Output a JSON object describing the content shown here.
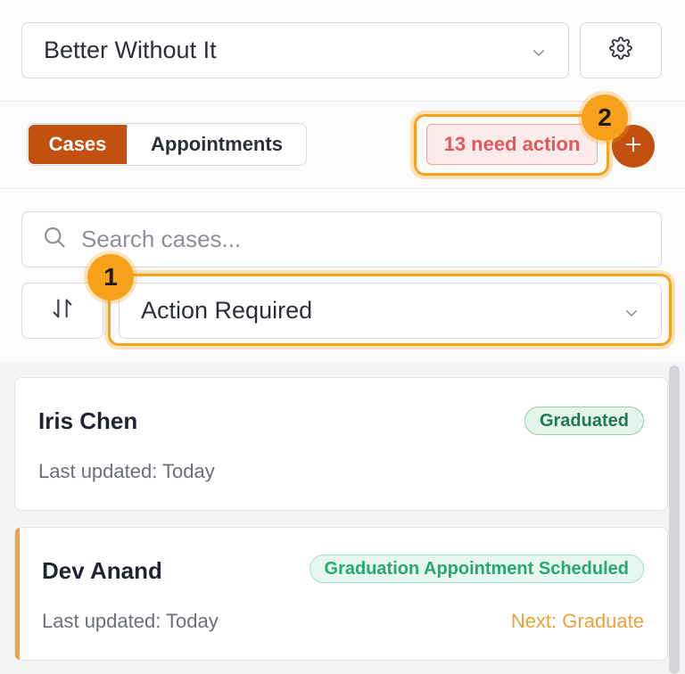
{
  "program": {
    "selected": "Better Without It"
  },
  "tabs": [
    {
      "label": "Cases",
      "active": true
    },
    {
      "label": "Appointments",
      "active": false
    }
  ],
  "need_action": {
    "label": "13 need action"
  },
  "markers": {
    "one": "1",
    "two": "2"
  },
  "search": {
    "placeholder": "Search cases..."
  },
  "filter": {
    "selected": "Action Required"
  },
  "cases": [
    {
      "name": "Iris Chen",
      "status": "Graduated",
      "updated": "Last updated: Today",
      "next": ""
    },
    {
      "name": "Dev Anand",
      "status": "Graduation Appointment Scheduled",
      "updated": "Last updated: Today",
      "next": "Next: Graduate"
    }
  ],
  "colors": {
    "brand": "#c2500e",
    "highlight": "#f7a21a",
    "alert": "#e1585b",
    "success": "#27a96e"
  },
  "icons": {
    "chevron": "chevron-down-icon",
    "settings": "gear-icon",
    "search": "search-icon",
    "sort": "sort-arrows-icon",
    "add": "plus-icon"
  }
}
